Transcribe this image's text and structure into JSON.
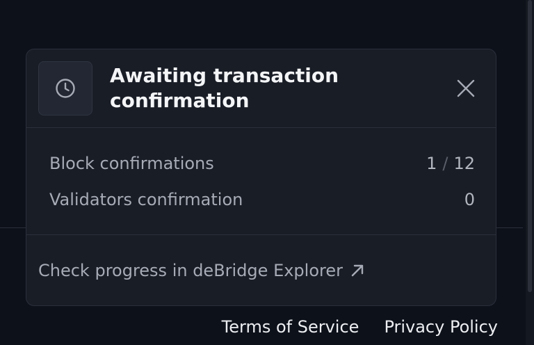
{
  "toast": {
    "title": "Awaiting transaction confirmation",
    "status_icon": "clock-icon",
    "close_icon": "close-icon",
    "rows": [
      {
        "label": "Block confirmations",
        "current": "1",
        "separator": "/",
        "total": "12"
      },
      {
        "label": "Validators confirmation",
        "value": "0"
      }
    ],
    "link": {
      "label": "Check progress in deBridge Explorer",
      "icon": "external-arrow-icon"
    }
  },
  "footer": {
    "links": [
      "Terms of Service",
      "Privacy Policy"
    ]
  }
}
